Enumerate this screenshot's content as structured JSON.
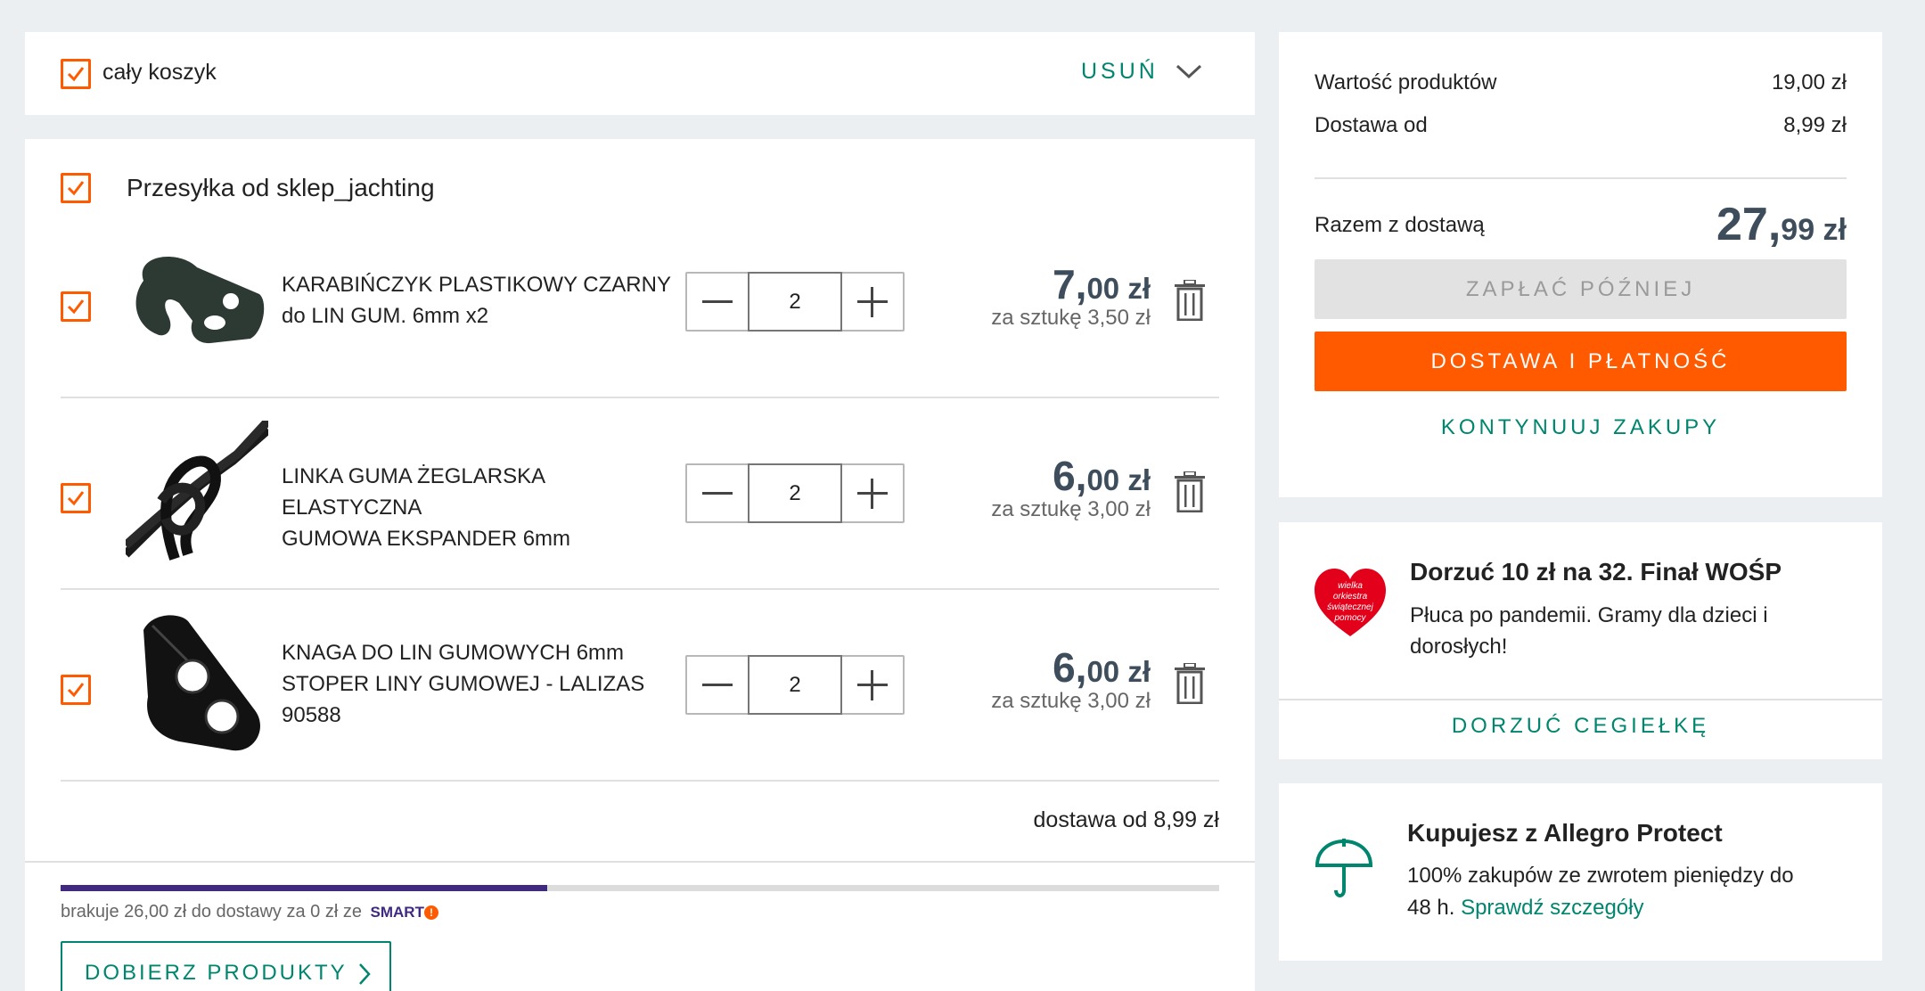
{
  "cart_header": {
    "select_all_label": "cały koszyk",
    "remove_label": "USUŃ"
  },
  "shipment": {
    "seller_label": "Przesyłka od sklep_jachting",
    "items": [
      {
        "name_line1": "KARABIŃCZYK PLASTIKOWY CZARNY",
        "name_line2": "do LIN GUM. 6mm x2",
        "name_line3": "",
        "quantity": "2",
        "price_int": "7,",
        "price_dec": "00 zł",
        "unit_price": "za sztukę 3,50 zł"
      },
      {
        "name_line1": "LINKA GUMA ŻEGLARSKA ELASTYCZNA",
        "name_line2": "GUMOWA EKSPANDER 6mm",
        "name_line3": "",
        "quantity": "2",
        "price_int": "6,",
        "price_dec": "00 zł",
        "unit_price": "za sztukę 3,00 zł"
      },
      {
        "name_line1": "KNAGA DO LIN GUMOWYCH 6mm",
        "name_line2": "STOPER LINY GUMOWEJ - LALIZAS",
        "name_line3": "90588",
        "quantity": "2",
        "price_int": "6,",
        "price_dec": "00 zł",
        "unit_price": "za sztukę 3,00 zł"
      }
    ],
    "delivery_from": "dostawa od 8,99 zł",
    "smart_progress": 0.42,
    "smart_missing_text": "brakuje 26,00 zł do dostawy za 0 zł ze",
    "smart_logo": "SMART",
    "pick_products_label": "DOBIERZ PRODUKTY"
  },
  "summary": {
    "products_value_label": "Wartość produktów",
    "products_value": "19,00 zł",
    "delivery_label": "Dostawa od",
    "delivery_value": "8,99 zł",
    "total_label": "Razem z dostawą",
    "total_int": "27,",
    "total_dec": "99 zł",
    "pay_later_label": "ZAPŁAĆ PÓŹNIEJ",
    "checkout_label": "DOSTAWA I PŁATNOŚĆ",
    "continue_label": "KONTYNUUJ ZAKUPY"
  },
  "wosp": {
    "logo_text": "wielka orkiestra świątecznej pomocy",
    "title": "Dorzuć 10 zł na 32. Finał WOŚP",
    "desc_line1": "Płuca po pandemii. Gramy dla dzieci i",
    "desc_line2": "dorosłych!",
    "donate_label": "DORZUĆ CEGIEŁKĘ"
  },
  "protect": {
    "title": "Kupujesz z Allegro Protect",
    "desc_line1": "100% zakupów ze zwrotem pieniędzy do",
    "desc_line2": "48 h.",
    "details_link": "Sprawdź szczegóły"
  },
  "colors": {
    "accent_orange": "#ff5a00",
    "teal": "#00856f",
    "smart_purple": "#3f2a80",
    "wosp_red": "#e2001a"
  }
}
